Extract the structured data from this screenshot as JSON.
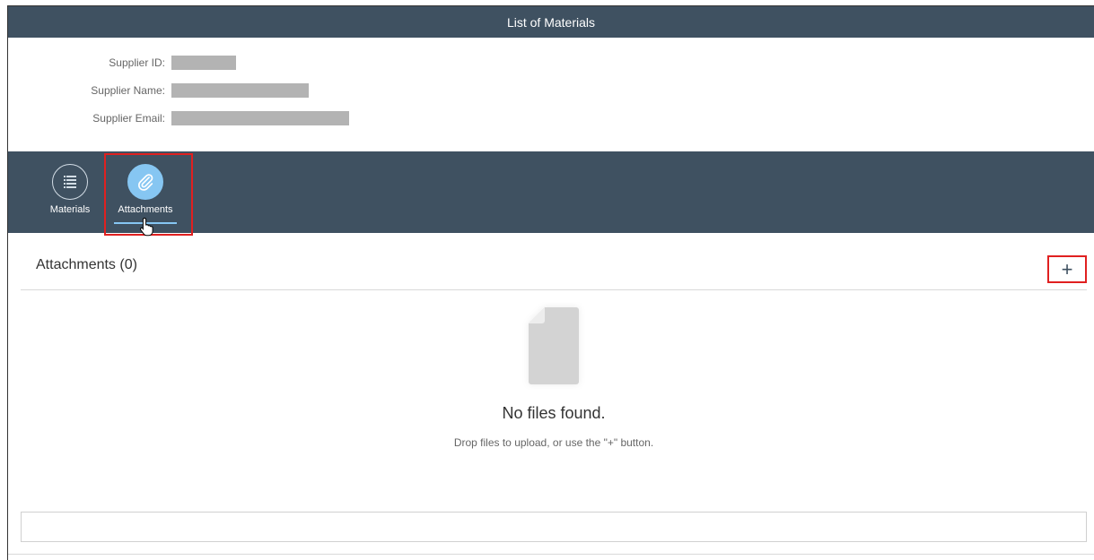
{
  "window": {
    "title": "List of Materials"
  },
  "header": {
    "fields": [
      {
        "label": "Supplier ID:"
      },
      {
        "label": "Supplier Name:"
      },
      {
        "label": "Supplier Email:"
      }
    ]
  },
  "tabs": [
    {
      "label": "Materials",
      "icon": "list-icon",
      "selected": false
    },
    {
      "label": "Attachments",
      "icon": "paperclip-icon",
      "selected": true
    }
  ],
  "attachments": {
    "title": "Attachments (0)",
    "add_label": "+",
    "empty_title": "No files found.",
    "empty_hint": "Drop files to upload, or use the \"+\" button."
  },
  "colors": {
    "shell": "#3f5161",
    "accent": "#86c6f2",
    "highlight": "#e02020"
  }
}
